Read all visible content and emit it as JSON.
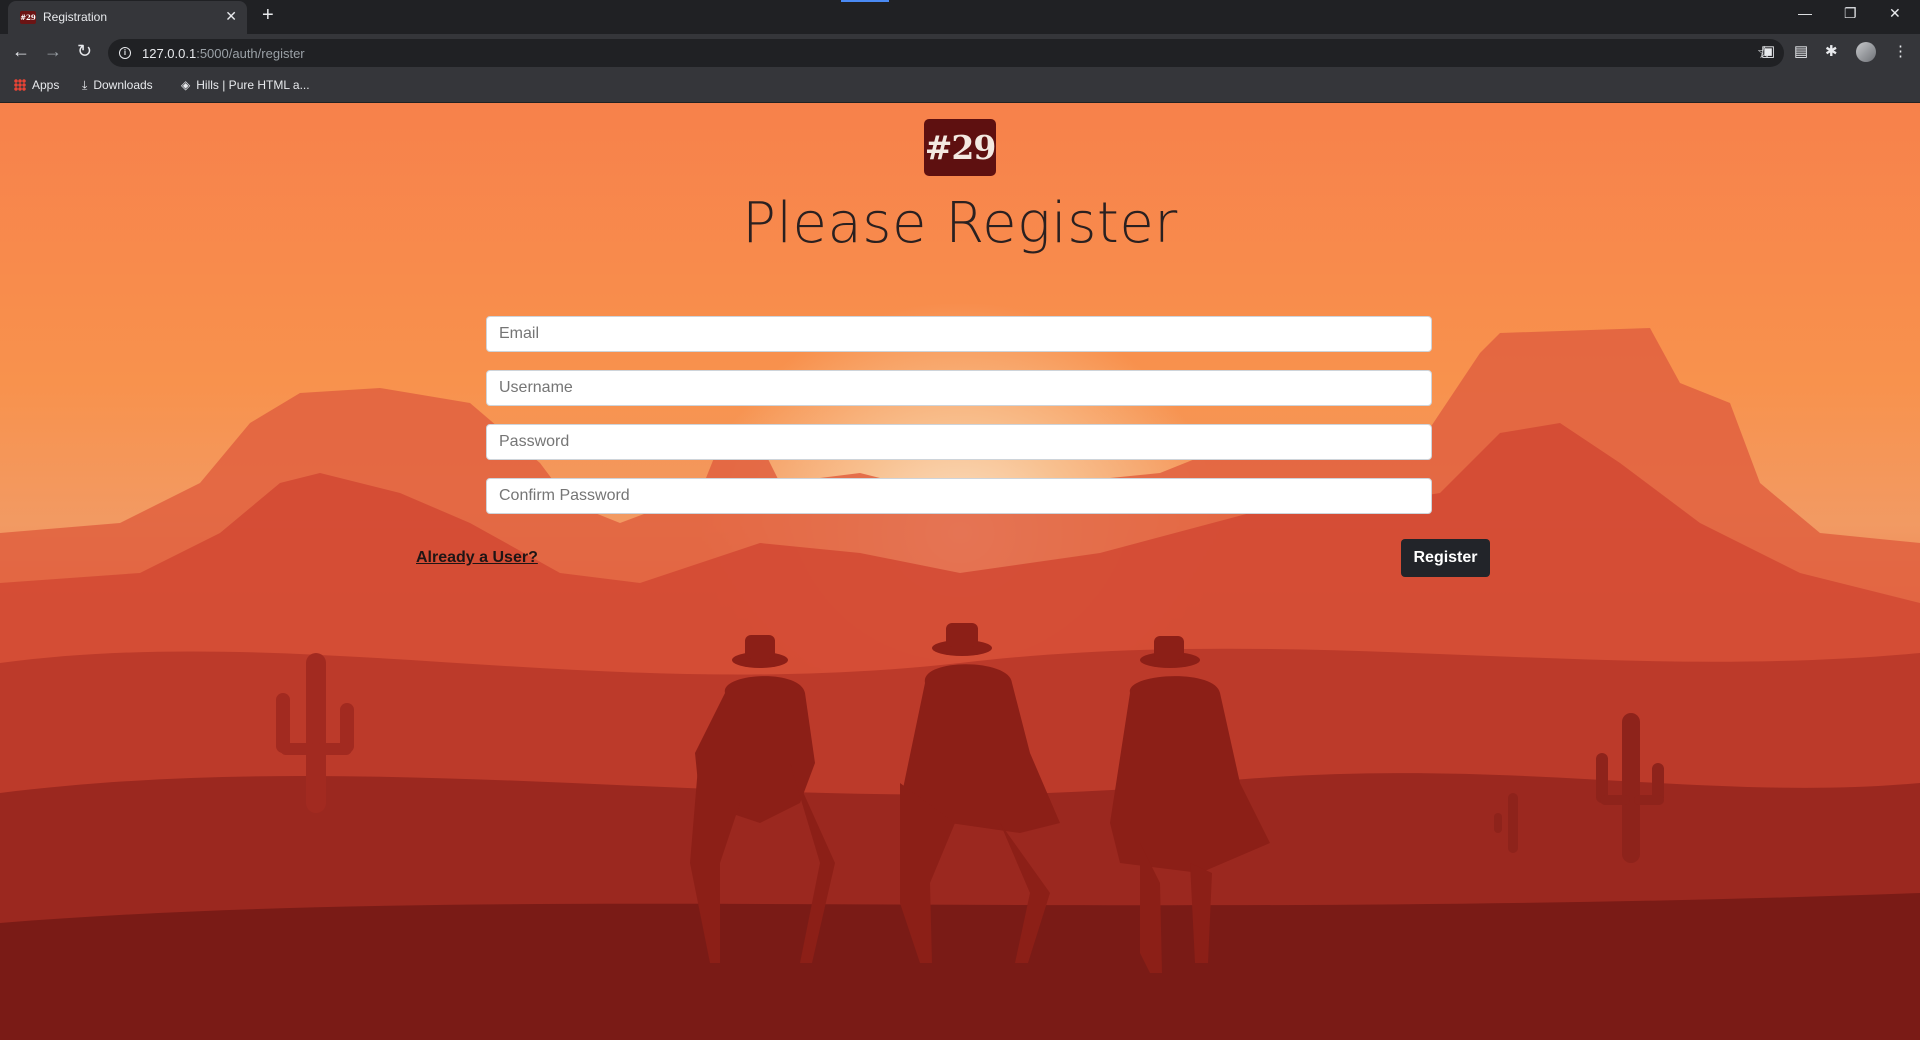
{
  "browser": {
    "tab_title": "Registration",
    "tab_favicon_text": "#29",
    "url_host": "127.0.0.1",
    "url_rest": ":5000/auth/register",
    "bookmarks": [
      {
        "label": "Apps",
        "icon": "apps-grid-icon"
      },
      {
        "label": "Downloads",
        "icon": "download-icon"
      },
      {
        "label": "Hills | Pure HTML a...",
        "icon": "site-icon"
      }
    ]
  },
  "page": {
    "logo_text": "#29",
    "heading": "Please Register",
    "fields": {
      "email_placeholder": "Email",
      "username_placeholder": "Username",
      "password_placeholder": "Password",
      "confirm_placeholder": "Confirm Password"
    },
    "login_link": "Already a User?",
    "register_button": "Register"
  },
  "colors": {
    "sky_top": "#f7814b",
    "sun_glow": "#fbe3c8",
    "mountain": "#d94c35",
    "foreground": "#7a1b16",
    "button_bg": "#222429",
    "logo_bg": "#5e1010"
  }
}
